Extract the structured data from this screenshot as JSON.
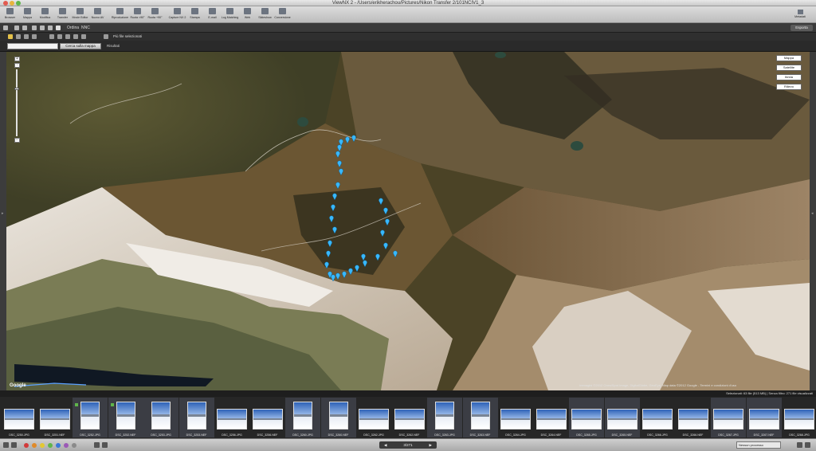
{
  "window": {
    "title": "ViewNX 2 - /Users/erikherachou/Pictures/Nikon Transfer 2/101NCIV1_3"
  },
  "toolbar": {
    "buttons": [
      {
        "label": "Browser",
        "icon": "browser-icon"
      },
      {
        "label": "Mappa",
        "icon": "map-icon"
      },
      {
        "label": "Modifica",
        "icon": "edit-icon"
      },
      {
        "label": "Transfer",
        "icon": "transfer-icon"
      },
      {
        "label": "Movie Editor",
        "icon": "movie-editor-icon"
      },
      {
        "label": "Nuovo AV",
        "icon": "audio-video-icon"
      },
      {
        "label": "Riproduzione",
        "icon": "play-icon"
      },
      {
        "label": "Ruota <90°",
        "icon": "rotate-left-icon"
      },
      {
        "label": "Ruota +90°",
        "icon": "rotate-right-icon"
      },
      {
        "label": "Capture NX 2",
        "icon": "capture-nx-icon"
      },
      {
        "label": "Stampa",
        "icon": "print-icon"
      },
      {
        "label": "E-mail",
        "icon": "mail-icon"
      },
      {
        "label": "Log Matching",
        "icon": "log-matching-icon"
      },
      {
        "label": "Web",
        "icon": "web-icon"
      },
      {
        "label": "Slideshow",
        "icon": "slideshow-icon"
      },
      {
        "label": "Conversione",
        "icon": "convert-icon"
      }
    ],
    "right_button": {
      "label": "Metadati",
      "icon": "metadata-icon"
    }
  },
  "subbar": {
    "sort_label": "Ordina",
    "sort_value": "NNC",
    "export_label": "Esporta"
  },
  "maptools": {
    "selected_files_label": "Più file selezionati"
  },
  "search": {
    "input_value": "",
    "button_label": "Cerca sulla mappa",
    "results_label": "Risultati"
  },
  "map": {
    "type_buttons": [
      "Mappa",
      "Satellite",
      "Ibrida",
      "Rilievo"
    ],
    "zoom_level_fraction": 0.27,
    "attribution": "Immagini ©2012 Cnes/Spot Image, DigitalGlobe, GeoEye, Map data ©2012 Google - Termini e condizioni d'uso",
    "logo": "Google"
  },
  "statusline": {
    "selection": "Selezionati: 63 file (513 MB) | Senza filtro: 271 file visualizzati"
  },
  "filmstrip": {
    "thumbs": [
      {
        "label": "DSC_3250.JPG",
        "selected": false,
        "orientation": "landscape",
        "flag": false
      },
      {
        "label": "DSC_3251.NEF",
        "selected": false,
        "orientation": "landscape",
        "flag": false
      },
      {
        "label": "DSC_3252.JPG",
        "selected": true,
        "orientation": "portrait",
        "flag": true
      },
      {
        "label": "DSC_3252.NEF",
        "selected": true,
        "orientation": "portrait",
        "flag": true
      },
      {
        "label": "DSC_3253.JPG",
        "selected": true,
        "orientation": "portrait",
        "flag": false
      },
      {
        "label": "DSC_3253.NEF",
        "selected": true,
        "orientation": "portrait",
        "flag": false
      },
      {
        "label": "DSC_3256.JPG",
        "selected": false,
        "orientation": "landscape",
        "flag": false
      },
      {
        "label": "DSC_3256.NEF",
        "selected": false,
        "orientation": "landscape",
        "flag": false
      },
      {
        "label": "DSC_3260.JPG",
        "selected": true,
        "orientation": "portrait",
        "flag": false
      },
      {
        "label": "DSC_3260.NEF",
        "selected": true,
        "orientation": "portrait",
        "flag": false
      },
      {
        "label": "DSC_3262.JPG",
        "selected": false,
        "orientation": "landscape",
        "flag": false
      },
      {
        "label": "DSC_3262.NEF",
        "selected": false,
        "orientation": "landscape",
        "flag": false
      },
      {
        "label": "DSC_3263.JPG",
        "selected": true,
        "orientation": "portrait",
        "flag": false
      },
      {
        "label": "DSC_3263.NEF",
        "selected": true,
        "orientation": "portrait",
        "flag": false
      },
      {
        "label": "DSC_3264.JPG",
        "selected": false,
        "orientation": "landscape",
        "flag": false
      },
      {
        "label": "DSC_3264.NEF",
        "selected": false,
        "orientation": "landscape",
        "flag": false
      },
      {
        "label": "DSC_3265.JPG",
        "selected": true,
        "orientation": "landscape",
        "flag": false
      },
      {
        "label": "DSC_3265.NEF",
        "selected": true,
        "orientation": "landscape",
        "flag": false
      },
      {
        "label": "DSC_3266.JPG",
        "selected": false,
        "orientation": "landscape",
        "flag": false
      },
      {
        "label": "DSC_3266.NEF",
        "selected": false,
        "orientation": "landscape",
        "flag": false
      },
      {
        "label": "DSC_3267.JPG",
        "selected": true,
        "orientation": "landscape",
        "flag": false
      },
      {
        "label": "DSC_3267.NEF",
        "selected": true,
        "orientation": "landscape",
        "flag": false
      },
      {
        "label": "DSC_3268.JPG",
        "selected": false,
        "orientation": "landscape",
        "flag": false
      }
    ]
  },
  "statusbar": {
    "rating_colors": [
      "#d23a3a",
      "#e08a2a",
      "#e3c832",
      "#5fb54a",
      "#3b78d8",
      "#9b59b6",
      "#8a8a8a"
    ],
    "pager_label": "3/271",
    "sort_select": "Nessun processo"
  },
  "colors": {
    "map_marker": "#38b8ff",
    "selection_bg": "#3b3d44"
  }
}
